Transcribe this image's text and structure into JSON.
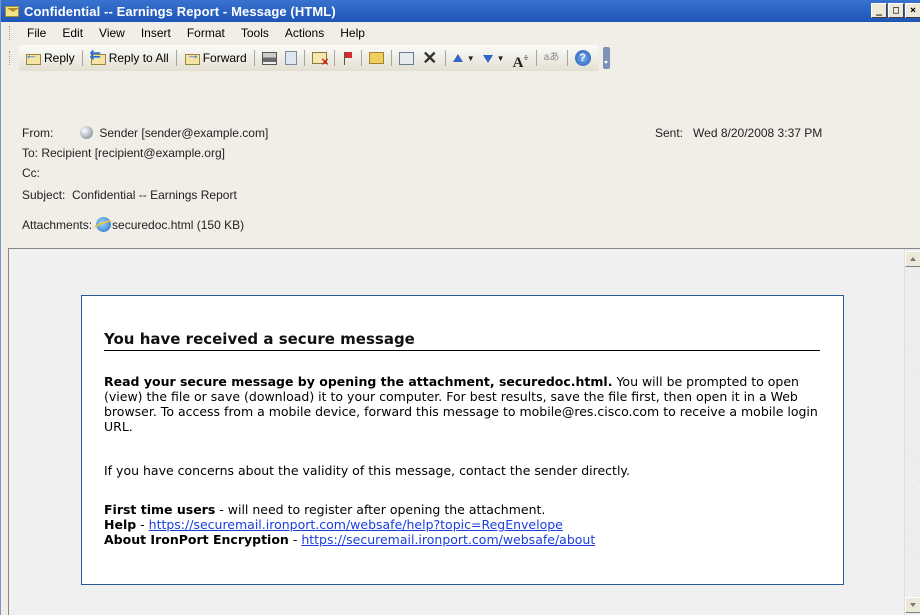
{
  "window": {
    "title": "Confidential -- Earnings Report - Message (HTML)",
    "controls": [
      "_",
      "□",
      "×"
    ]
  },
  "menu": [
    "File",
    "Edit",
    "View",
    "Insert",
    "Format",
    "Tools",
    "Actions",
    "Help"
  ],
  "toolbar": {
    "reply": "Reply",
    "reply_all": "Reply to All",
    "forward": "Forward"
  },
  "header": {
    "from_label": "From:",
    "from_value": "Sender [sender@example.com]",
    "sent_label": "Sent:",
    "sent_value": "Wed 8/20/2008 3:37 PM",
    "to_line": "To: Recipient [recipient@example.org]",
    "cc_label": "Cc:",
    "subject_label": "Subject:",
    "subject_value": "Confidential -- Earnings Report",
    "attachments_label": "Attachments:",
    "attachment_name": "securedoc.html (150 KB)"
  },
  "message": {
    "title": "You have received a secure message",
    "p1_bold": "Read your secure message by opening the attachment, securedoc.html.",
    "p1_text": " You will be prompted to open (view) the file or save (download) it to your computer. For best results, save the file first, then open it in a Web browser. To access from a mobile device, forward this message to mobile@res.cisco.com to receive a mobile login URL.",
    "p2": "If you have concerns about the validity of this message, contact the sender directly.",
    "first_time_bold": "First time users",
    "first_time_text": " - will need to register after opening the attachment.",
    "help_bold": "Help",
    "help_sep": " - ",
    "help_link": "https://securemail.ironport.com/websafe/help?topic=RegEnvelope",
    "about_bold": "About IronPort Encryption",
    "about_sep": " - ",
    "about_link": "https://securemail.ironport.com/websafe/about"
  }
}
